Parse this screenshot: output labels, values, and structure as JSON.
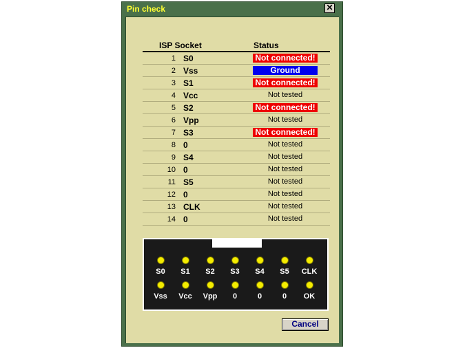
{
  "window": {
    "title": "Pin check",
    "close_glyph": "✕"
  },
  "table": {
    "header_socket": "ISP Socket",
    "header_status": "Status",
    "rows": [
      {
        "num": "1",
        "pin": "S0",
        "status": "Not connected!",
        "kind": "red"
      },
      {
        "num": "2",
        "pin": "Vss",
        "status": "Ground",
        "kind": "blue"
      },
      {
        "num": "3",
        "pin": "S1",
        "status": "Not connected!",
        "kind": "red"
      },
      {
        "num": "4",
        "pin": "Vcc",
        "status": "Not tested",
        "kind": "plain"
      },
      {
        "num": "5",
        "pin": "S2",
        "status": "Not connected!",
        "kind": "red"
      },
      {
        "num": "6",
        "pin": "Vpp",
        "status": "Not tested",
        "kind": "plain"
      },
      {
        "num": "7",
        "pin": "S3",
        "status": "Not connected!",
        "kind": "red"
      },
      {
        "num": "8",
        "pin": "0",
        "status": "Not tested",
        "kind": "plain"
      },
      {
        "num": "9",
        "pin": "S4",
        "status": "Not tested",
        "kind": "plain"
      },
      {
        "num": "10",
        "pin": "0",
        "status": "Not tested",
        "kind": "plain"
      },
      {
        "num": "11",
        "pin": "S5",
        "status": "Not tested",
        "kind": "plain"
      },
      {
        "num": "12",
        "pin": "0",
        "status": "Not tested",
        "kind": "plain"
      },
      {
        "num": "13",
        "pin": "CLK",
        "status": "Not tested",
        "kind": "plain"
      },
      {
        "num": "14",
        "pin": "0",
        "status": "Not tested",
        "kind": "plain"
      }
    ]
  },
  "connector": {
    "top_labels": [
      "S0",
      "S1",
      "S2",
      "S3",
      "S4",
      "S5",
      "CLK"
    ],
    "bottom_labels": [
      "Vss",
      "Vcc",
      "Vpp",
      "0",
      "0",
      "0",
      "OK"
    ],
    "led_color": "#f4ec00"
  },
  "buttons": {
    "cancel_label": "Cancel"
  },
  "colors": {
    "not_connected": "#ee0000",
    "ground": "#0000ee",
    "title_text": "#ffff33",
    "panel": "#e0dca6"
  }
}
